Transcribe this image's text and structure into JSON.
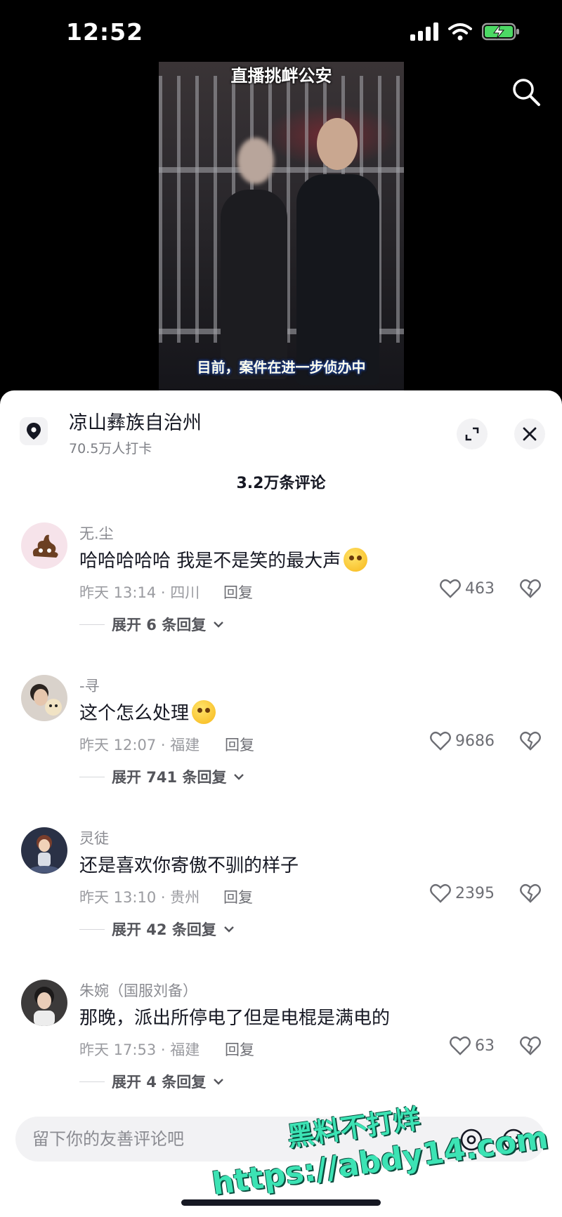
{
  "status_bar": {
    "time": "12:52"
  },
  "video": {
    "caption_top": "直播挑衅公安",
    "caption_bottom": "目前，案件在进一步侦办中"
  },
  "location": {
    "name": "凉山彝族自治州",
    "checkins": "70.5万人打卡"
  },
  "comment_count": "3.2万条评论",
  "comments": [
    {
      "user": "无.尘",
      "text": "哈哈哈哈哈   我是不是笑的最大声",
      "time_loc": "昨天 13:14 · 四川",
      "reply": "回复",
      "likes": "463",
      "expand": "展开 6 条回复"
    },
    {
      "user": "-寻",
      "text": "这个怎么处理",
      "time_loc": "昨天 12:07 · 福建",
      "reply": "回复",
      "likes": "9686",
      "expand": "展开 741 条回复"
    },
    {
      "user": "灵徒",
      "text": "还是喜欢你寄傲不驯的样子",
      "time_loc": "昨天 13:10 · 贵州",
      "reply": "回复",
      "likes": "2395",
      "expand": "展开 42 条回复"
    },
    {
      "user": "朱婉（国服刘备）",
      "text": "那晚，派出所停电了但是电棍是满电的",
      "time_loc": "昨天 17:53 · 福建",
      "reply": "回复",
      "likes": "63",
      "expand": "展开 4 条回复"
    }
  ],
  "input": {
    "placeholder": "留下你的友善评论吧"
  },
  "watermark": {
    "line1": "黑料不打烊",
    "line2": "https://abdy14.com"
  }
}
